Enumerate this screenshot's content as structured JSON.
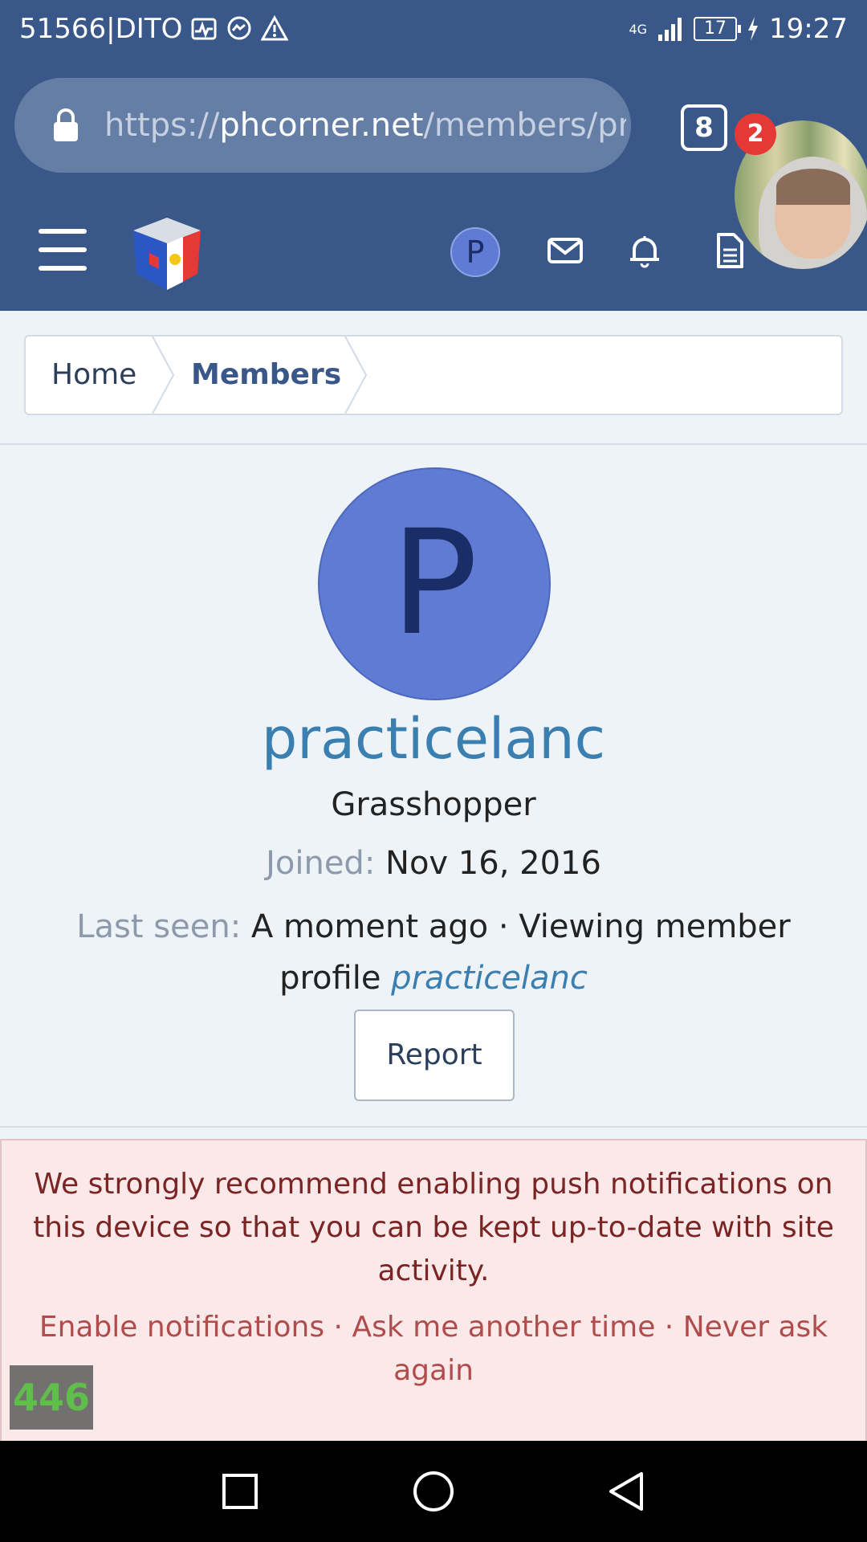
{
  "status_bar": {
    "carrier": "51566|DITO",
    "network": "4G",
    "battery": "17",
    "time": "19:27"
  },
  "browser": {
    "url_prefix": "https://",
    "url_host": "phcorner.net",
    "url_path": "/members/pra",
    "tab_count": "8"
  },
  "header": {
    "avatar_letter": "P",
    "icons": [
      "menu-icon",
      "site-logo",
      "avatar",
      "mail-icon",
      "bell-icon",
      "document-icon"
    ]
  },
  "chat_head": {
    "badge": "2"
  },
  "breadcrumb": {
    "items": [
      "Home",
      "Members"
    ]
  },
  "profile": {
    "avatar_letter": "P",
    "username": "practicelanc",
    "user_title": "Grasshopper",
    "joined_label": "Joined:",
    "joined_value": "Nov 16, 2016",
    "last_seen_label": "Last seen:",
    "last_seen_value": "A moment ago · Viewing member profile",
    "last_seen_link": "practicelanc",
    "report_label": "Report"
  },
  "notice": {
    "message": "We strongly recommend enabling push notifications on this device so that you can be kept up-to-date with site activity.",
    "enable": "Enable notifications",
    "sep1": " · ",
    "later": "Ask me another time",
    "sep2": " · ",
    "never": "Never ask again"
  },
  "overlay": {
    "counter": "446"
  },
  "colors": {
    "header_bg": "#3a5789",
    "avatar_bg": "#5f7bd4",
    "username": "#3a7fb0",
    "notice_bg": "#fbe9e9",
    "notice_text": "#7a2424"
  }
}
